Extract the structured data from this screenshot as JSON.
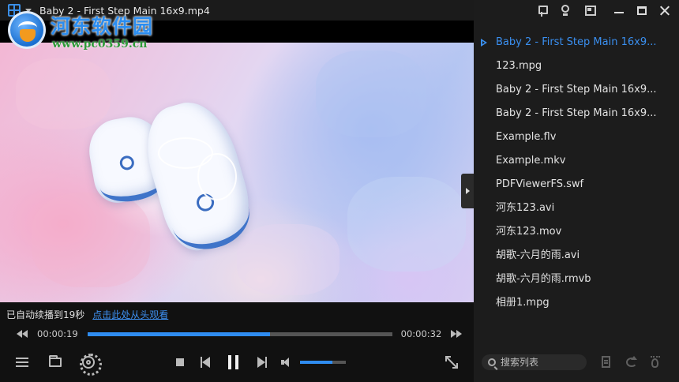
{
  "window": {
    "title": "Baby 2 - First Step Main 16x9.mp4"
  },
  "watermark": {
    "name": "河东软件园",
    "url": "www.pc0359.cn"
  },
  "resume": {
    "message": "已自动续播到19秒",
    "link": "点击此处从头观看"
  },
  "progress": {
    "current_time": "00:00:19",
    "total_time": "00:00:32",
    "fraction": 0.6
  },
  "volume": {
    "fraction": 0.7
  },
  "playlist": {
    "items": [
      {
        "label": "Baby 2 - First Step Main 16x9...",
        "active": true
      },
      {
        "label": "123.mpg",
        "active": false
      },
      {
        "label": "Baby 2 - First Step Main 16x9...",
        "active": false
      },
      {
        "label": "Baby 2 - First Step Main 16x9...",
        "active": false
      },
      {
        "label": "Example.flv",
        "active": false
      },
      {
        "label": "Example.mkv",
        "active": false
      },
      {
        "label": "PDFViewerFS.swf",
        "active": false
      },
      {
        "label": "河东123.avi",
        "active": false
      },
      {
        "label": "河东123.mov",
        "active": false
      },
      {
        "label": "胡歌-六月的雨.avi",
        "active": false
      },
      {
        "label": "胡歌-六月的雨.rmvb",
        "active": false
      },
      {
        "label": "相册1.mpg",
        "active": false
      }
    ],
    "search_placeholder": "搜索列表"
  },
  "colors": {
    "accent": "#2f8cf0",
    "active_item": "#3a8ff0",
    "link": "#3d8ff0"
  }
}
